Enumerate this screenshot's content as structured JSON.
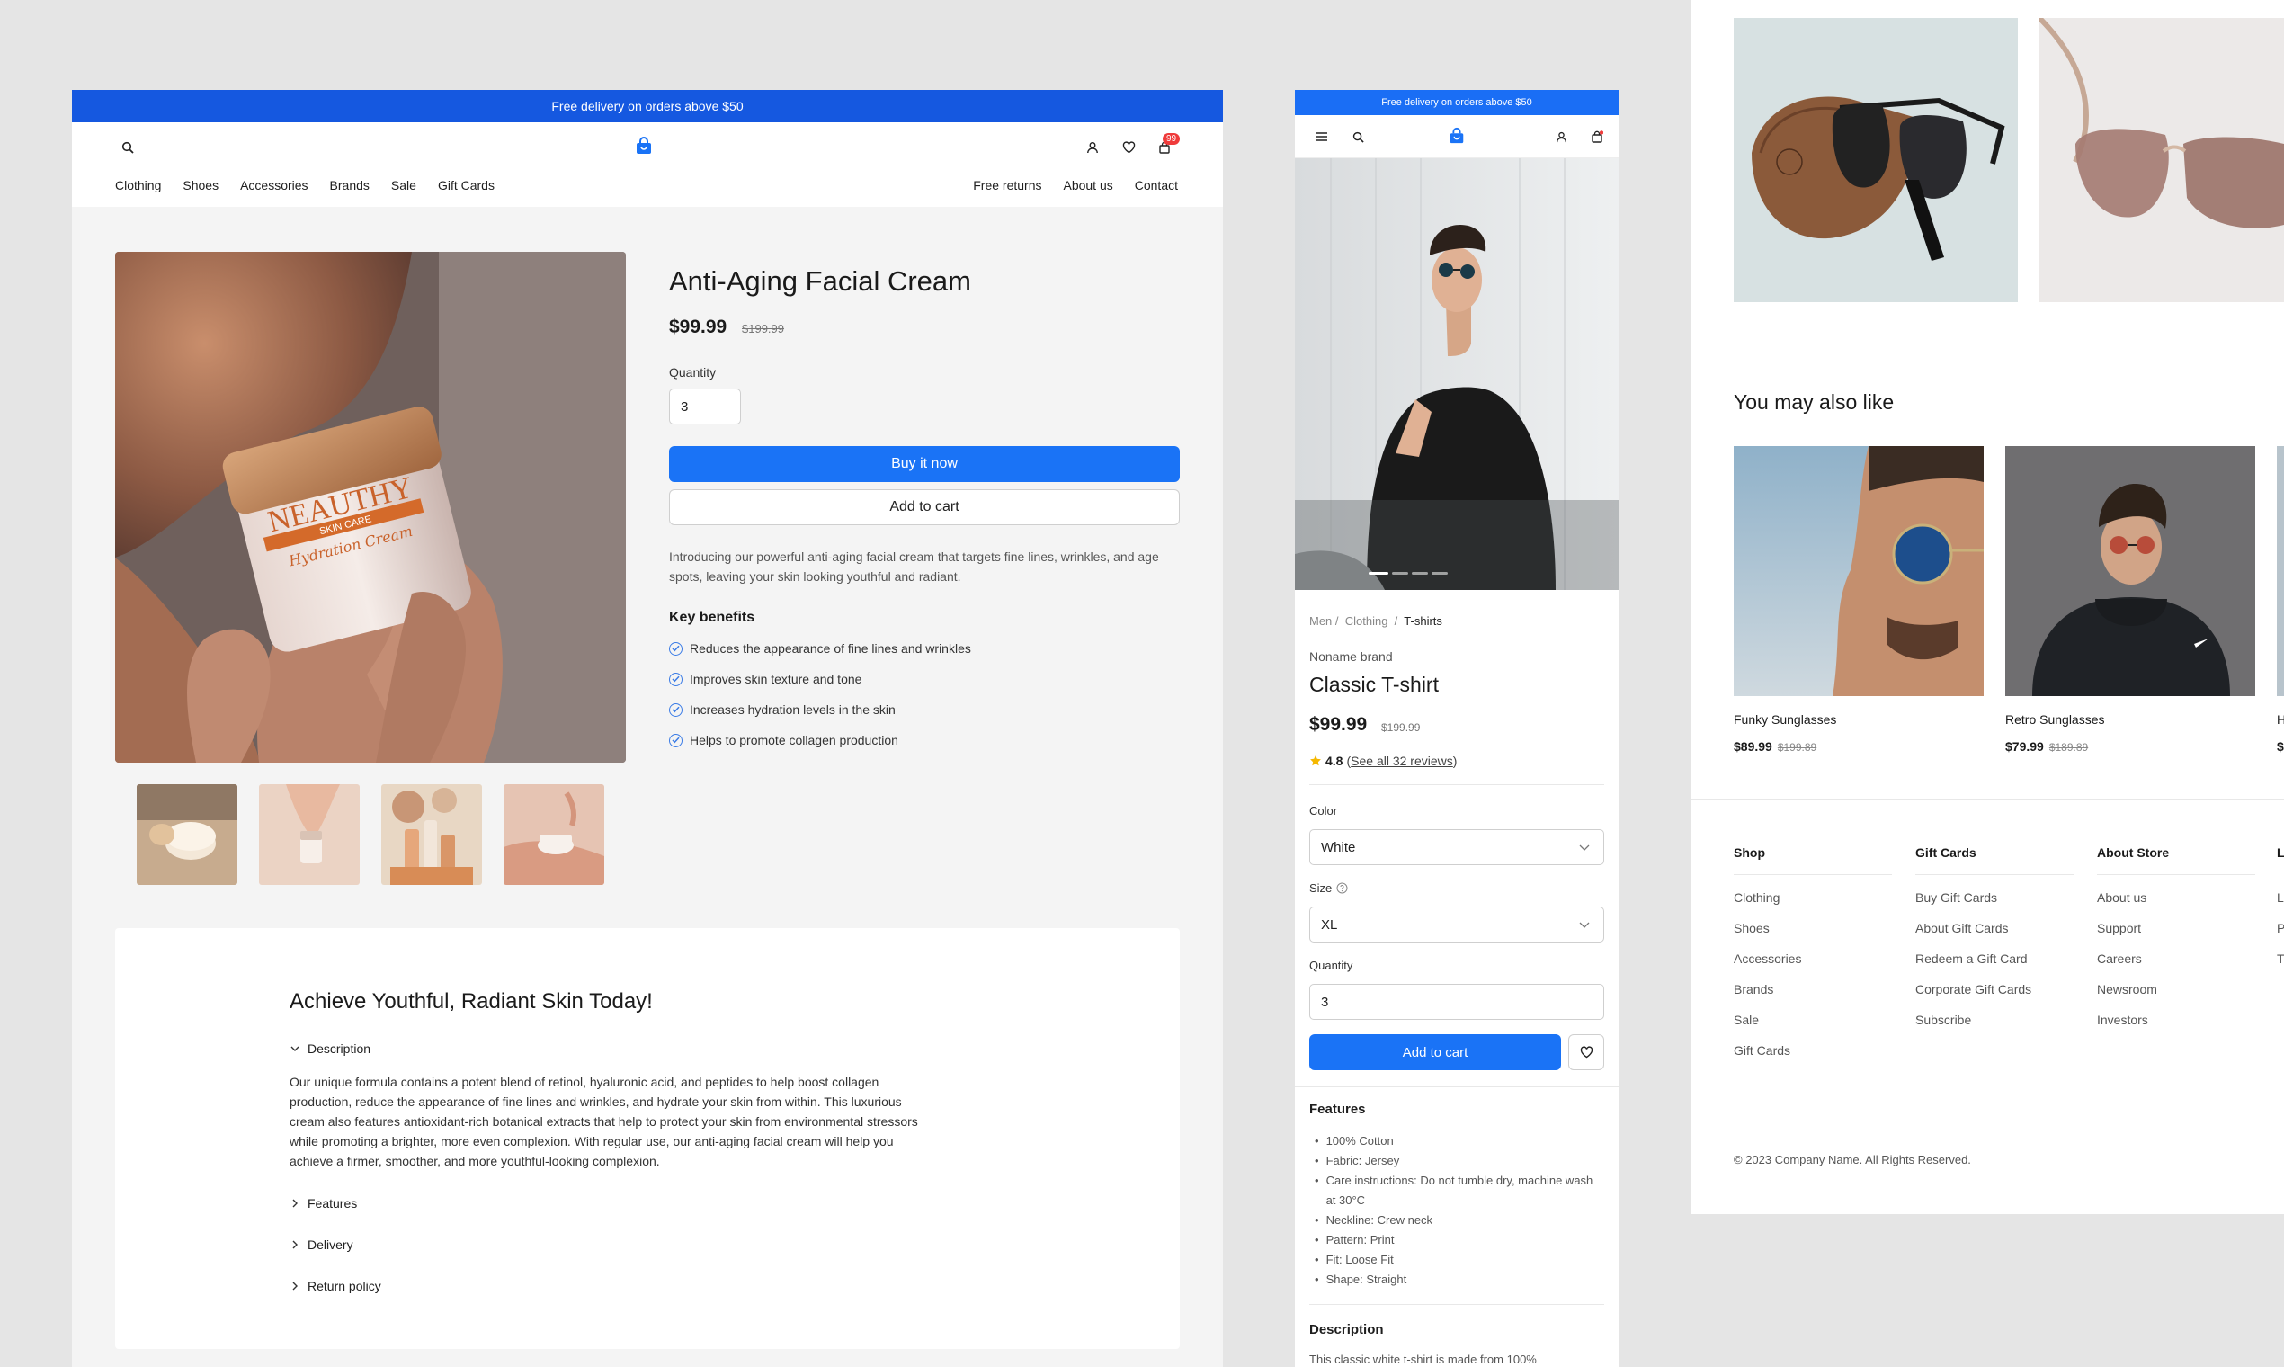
{
  "colors": {
    "primary": "#1a73f6",
    "banner": "#1558e0",
    "badge": "#ef3b3b",
    "star": "#f5b800"
  },
  "desktop": {
    "banner": "Free delivery on orders above $50",
    "cart_count": "99",
    "nav_left": [
      "Clothing",
      "Shoes",
      "Accessories",
      "Brands",
      "Sale",
      "Gift Cards"
    ],
    "nav_right": [
      "Free returns",
      "About us",
      "Contact"
    ],
    "product": {
      "title": "Anti-Aging Facial Cream",
      "price": "$99.99",
      "old_price": "$199.99",
      "quantity_label": "Quantity",
      "quantity": "3",
      "buy_now": "Buy it now",
      "add_to_cart": "Add to cart",
      "description": "Introducing our powerful anti-aging facial cream that targets fine lines, wrinkles, and age spots, leaving your skin looking youthful and radiant.",
      "benefits_title": "Key benefits",
      "benefits": [
        "Reduces the appearance of fine lines and wrinkles",
        "Improves skin texture and tone",
        "Increases hydration levels in the skin",
        "Helps to promote collagen production"
      ],
      "jar_brand": "NEAUTHY",
      "jar_line": "SKIN CARE",
      "jar_script": "Hydration Cream"
    },
    "details": {
      "title": "Achieve Youthful, Radiant Skin Today!",
      "accordion": [
        "Description",
        "Features",
        "Delivery",
        "Return policy"
      ],
      "description_text": "Our unique formula contains a potent blend of retinol, hyaluronic acid, and peptides to help boost collagen production, reduce the appearance of fine lines and wrinkles, and hydrate your skin from within. This luxurious cream also features antioxidant-rich botanical extracts that help to protect your skin from environmental stressors while promoting a brighter, more even complexion. With regular use, our anti-aging facial cream will help you achieve a firmer, smoother, and more youthful-looking complexion."
    }
  },
  "mobile": {
    "banner": "Free delivery on orders above $50",
    "breadcrumb": [
      "Men",
      "Clothing",
      "T-shirts"
    ],
    "brand": "Noname brand",
    "title": "Classic T-shirt",
    "price": "$99.99",
    "old_price": "$199.99",
    "rating": "4.8",
    "reviews_link": "See all 32 reviews",
    "color_label": "Color",
    "color_value": "White",
    "size_label": "Size",
    "size_value": "XL",
    "quantity_label": "Quantity",
    "quantity": "3",
    "add_to_cart": "Add to cart",
    "features_title": "Features",
    "features": [
      "100% Cotton",
      "Fabric: Jersey",
      "Care instructions: Do not tumble dry, machine wash at 30°C",
      "Neckline: Crew neck",
      "Pattern: Print",
      "Fit: Loose Fit",
      "Shape: Straight"
    ],
    "description_title": "Description",
    "description_text": "This classic white t-shirt is made from 100%"
  },
  "related": {
    "title": "You may also like",
    "products": [
      {
        "name": "Funky Sunglasses",
        "price": "$89.99",
        "old_price": "$199.89"
      },
      {
        "name": "Retro Sunglasses",
        "price": "$79.99",
        "old_price": "$189.89"
      },
      {
        "name": "H",
        "price": "$"
      }
    ]
  },
  "footer": {
    "columns": [
      {
        "title": "Shop",
        "links": [
          "Clothing",
          "Shoes",
          "Accessories",
          "Brands",
          "Sale",
          "Gift Cards"
        ]
      },
      {
        "title": "Gift Cards",
        "links": [
          "Buy Gift Cards",
          "About Gift Cards",
          "Redeem a Gift Card",
          "Corporate Gift Cards",
          "Subscribe"
        ]
      },
      {
        "title": "About Store",
        "links": [
          "About us",
          "Support",
          "Careers",
          "Newsroom",
          "Investors"
        ]
      },
      {
        "title": "L",
        "links": [
          "L",
          "P",
          "T"
        ]
      }
    ],
    "copyright": "© 2023 Company Name. All Rights Reserved."
  }
}
